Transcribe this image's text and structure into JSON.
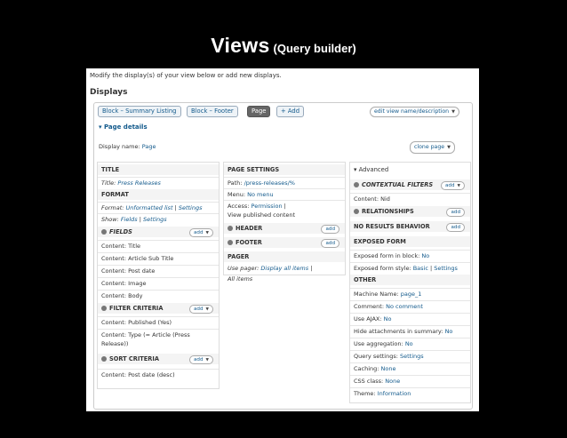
{
  "slide": {
    "title": "Views",
    "subtitle": "(Query builder)"
  },
  "intro": "Modify the display(s) of your view below or add new displays.",
  "displays_heading": "Displays",
  "tabs": [
    "Block – Summary Listing",
    "Block – Footer",
    "Page",
    "+ Add"
  ],
  "edit_view_name": "edit view name/description",
  "page_details": "▾ Page details",
  "display_name_label": "Display name:",
  "display_name_value": "Page",
  "clone_page": "clone page",
  "add_label": "add",
  "col1": {
    "title_h": "TITLE",
    "title_label": "Title:",
    "title_value": "Press Releases",
    "format_h": "FORMAT",
    "format_label": "Format:",
    "format_value": "Unformatted list",
    "format_sep": " | ",
    "format_settings": "Settings",
    "show_label": "Show:",
    "show_value": "Fields",
    "show_sep": " | ",
    "show_settings": "Settings",
    "fields_h": "FIELDS",
    "fields": [
      "Content: Title",
      "Content: Article Sub Title",
      "Content: Post date",
      "Content: Image",
      "Content: Body"
    ],
    "filter_h": "FILTER CRITERIA",
    "filters": [
      "Content: Published (Yes)",
      "Content: Type (= Article (Press",
      "Release))"
    ],
    "sort_h": "SORT CRITERIA",
    "sorts": [
      "Content: Post date (desc)"
    ]
  },
  "col2": {
    "page_settings_h": "PAGE SETTINGS",
    "path_label": "Path:",
    "path_value": "/press-releases/%",
    "menu_label": "Menu:",
    "menu_value": "No menu",
    "access_label": "Access:",
    "access_value": "Permission",
    "access_sep": " | ",
    "view_published": "View published content",
    "header_h": "HEADER",
    "footer_h": "FOOTER",
    "pager_h": "PAGER",
    "pager_label": "Use pager:",
    "pager_value": "Display all items",
    "pager_sep": " |",
    "pager_all": "All items"
  },
  "col3": {
    "advanced_h": "▾ Advanced",
    "contextual_h": "CONTEXTUAL FILTERS",
    "contextual_item": "Content: Nid",
    "relationships_h": "RELATIONSHIPS",
    "no_results_h": "NO RESULTS BEHAVIOR",
    "exposed_h": "EXPOSED FORM",
    "exposed_block_label": "Exposed form in block:",
    "exposed_block_value": "No",
    "exposed_style_label": "Exposed form style:",
    "exposed_style_value": "Basic",
    "exposed_style_sep": " | ",
    "exposed_style_settings": "Settings",
    "other_h": "OTHER",
    "machine_label": "Machine Name:",
    "machine_value": "page_1",
    "comment_label": "Comment:",
    "comment_value": "No comment",
    "ajax_label": "Use AJAX:",
    "ajax_value": "No",
    "hide_label": "Hide attachments in summary:",
    "hide_value": "No",
    "agg_label": "Use aggregation:",
    "agg_value": "No",
    "query_label": "Query settings:",
    "query_value": "Settings",
    "caching_label": "Caching:",
    "caching_value": "None",
    "css_label": "CSS class:",
    "css_value": "None",
    "theme_label": "Theme:",
    "theme_value": "Information"
  }
}
